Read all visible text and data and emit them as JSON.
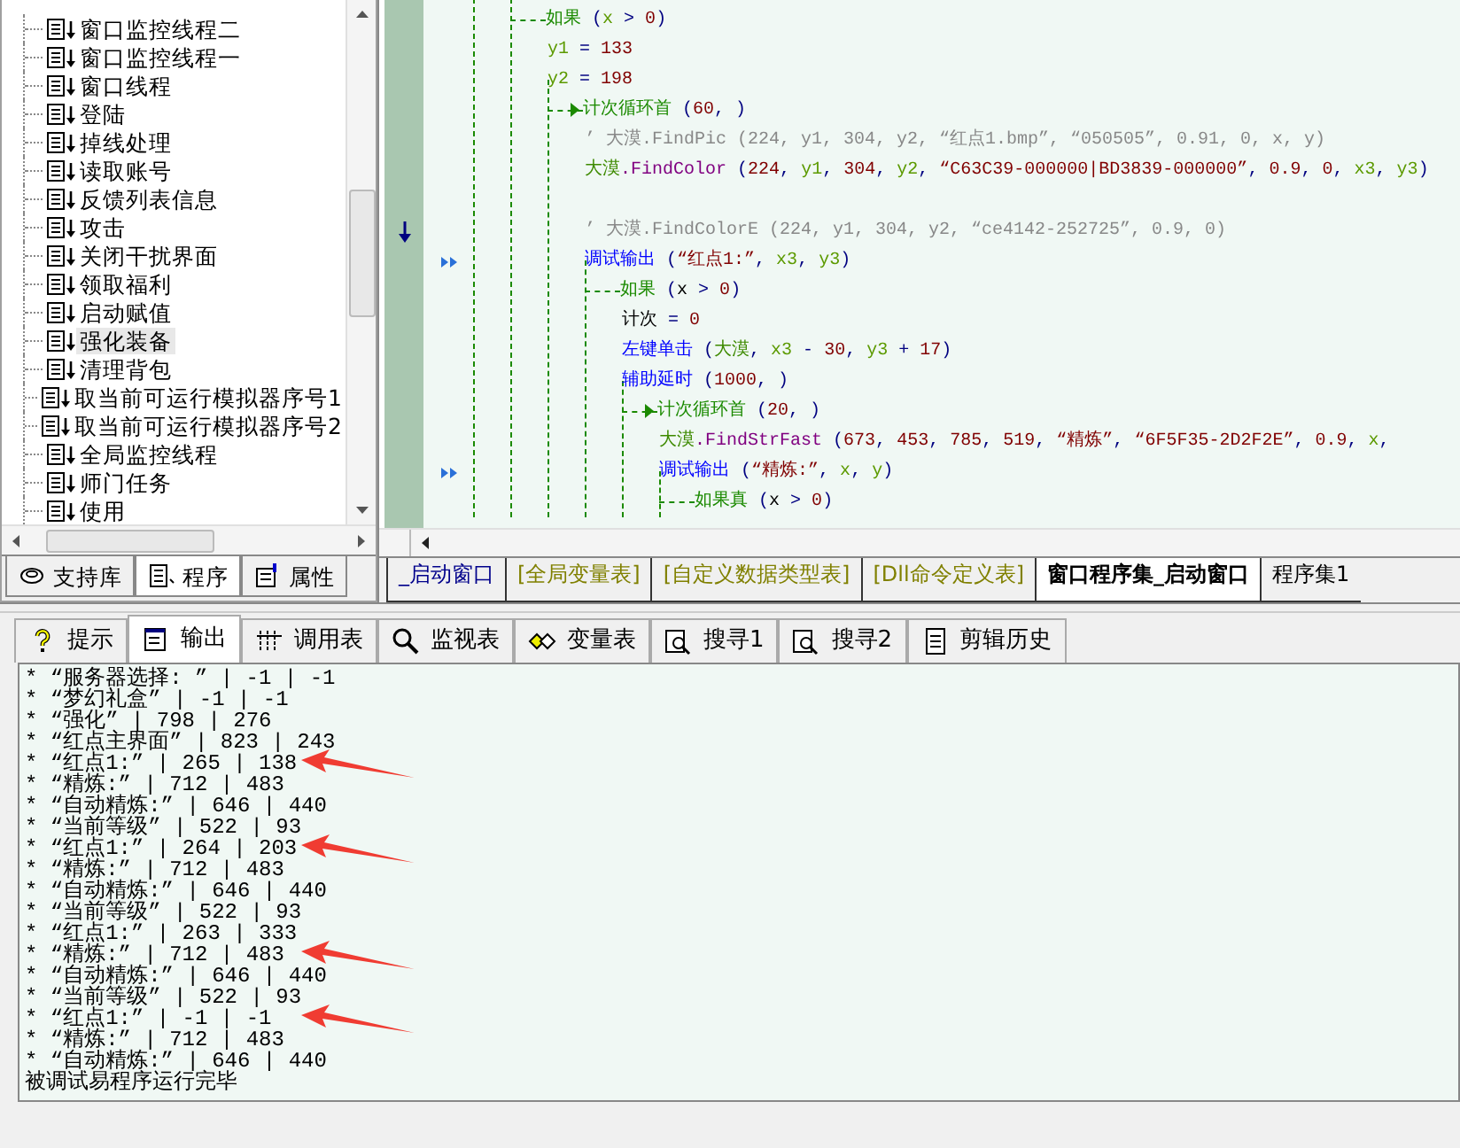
{
  "tree": {
    "items": [
      {
        "label": "窗口监控线程二",
        "selected": false
      },
      {
        "label": "窗口监控线程一",
        "selected": false
      },
      {
        "label": "窗口线程",
        "selected": false
      },
      {
        "label": "登陆",
        "selected": false
      },
      {
        "label": "掉线处理",
        "selected": false
      },
      {
        "label": "读取账号",
        "selected": false
      },
      {
        "label": "反馈列表信息",
        "selected": false
      },
      {
        "label": "攻击",
        "selected": false
      },
      {
        "label": "关闭干扰界面",
        "selected": false
      },
      {
        "label": "领取福利",
        "selected": false
      },
      {
        "label": "启动赋值",
        "selected": false
      },
      {
        "label": "强化装备",
        "selected": true
      },
      {
        "label": "清理背包",
        "selected": false
      },
      {
        "label": "取当前可运行模拟器序号1",
        "selected": false
      },
      {
        "label": "取当前可运行模拟器序号2",
        "selected": false
      },
      {
        "label": "全局监控线程",
        "selected": false
      },
      {
        "label": "师门任务",
        "selected": false
      },
      {
        "label": "使用",
        "selected": false
      }
    ]
  },
  "left_tabs": [
    {
      "label": "支持库",
      "selected": false
    },
    {
      "label": "程序",
      "selected": true
    },
    {
      "label": "属性",
      "selected": false
    }
  ],
  "code": {
    "lines": [
      {
        "kind": "if",
        "tokens": [
          {
            "kind": "flow",
            "text": "如果"
          },
          {
            "kind": "op",
            "text": " ("
          },
          {
            "kind": "var",
            "text": "x"
          },
          {
            "kind": "op",
            "text": " > "
          },
          {
            "kind": "num",
            "text": "0"
          },
          {
            "kind": "op",
            "text": ")"
          }
        ],
        "children": [
          {
            "kind": "stmt",
            "tokens": [
              {
                "kind": "var",
                "text": "y1"
              },
              {
                "kind": "op",
                "text": " = "
              },
              {
                "kind": "num",
                "text": "133"
              }
            ]
          },
          {
            "kind": "stmt",
            "tokens": [
              {
                "kind": "var",
                "text": "y2"
              },
              {
                "kind": "op",
                "text": " = "
              },
              {
                "kind": "num",
                "text": "198"
              }
            ]
          },
          {
            "kind": "loop",
            "tokens": [
              {
                "kind": "flow",
                "text": "计次循环首"
              },
              {
                "kind": "op",
                "text": " ("
              },
              {
                "kind": "num",
                "text": "60"
              },
              {
                "kind": "op",
                "text": ", )"
              }
            ],
            "children": [
              {
                "kind": "stmt",
                "tokens": [
                  {
                    "kind": "comment",
                    "text": "’ 大漠.FindPic (224, y1, 304, y2, “红点1.bmp”, “050505”, 0.91, 0, x, y)"
                  }
                ]
              },
              {
                "kind": "stmt",
                "tokens": [
                  {
                    "kind": "obj",
                    "text": "大漠"
                  },
                  {
                    "kind": "method",
                    "text": ".FindColor"
                  },
                  {
                    "kind": "op",
                    "text": " ("
                  },
                  {
                    "kind": "num",
                    "text": "224"
                  },
                  {
                    "kind": "op",
                    "text": ", "
                  },
                  {
                    "kind": "var",
                    "text": "y1"
                  },
                  {
                    "kind": "op",
                    "text": ", "
                  },
                  {
                    "kind": "num",
                    "text": "304"
                  },
                  {
                    "kind": "op",
                    "text": ", "
                  },
                  {
                    "kind": "var",
                    "text": "y2"
                  },
                  {
                    "kind": "op",
                    "text": ", "
                  },
                  {
                    "kind": "str",
                    "text": "“C63C39-000000|BD3839-000000”"
                  },
                  {
                    "kind": "op",
                    "text": ", "
                  },
                  {
                    "kind": "num",
                    "text": "0.9"
                  },
                  {
                    "kind": "op",
                    "text": ", "
                  },
                  {
                    "kind": "num",
                    "text": "0"
                  },
                  {
                    "kind": "op",
                    "text": ", "
                  },
                  {
                    "kind": "var",
                    "text": "x3"
                  },
                  {
                    "kind": "op",
                    "text": ", "
                  },
                  {
                    "kind": "var",
                    "text": "y3"
                  },
                  {
                    "kind": "op",
                    "text": ")"
                  }
                ]
              },
              {
                "kind": "blank"
              },
              {
                "kind": "stmt",
                "current": true,
                "traced": false,
                "tokens": [
                  {
                    "kind": "comment",
                    "text": "’ 大漠.FindColorE (224, y1, 304, y2, “ce4142-252725”, 0.9, 0)"
                  }
                ]
              },
              {
                "kind": "stmt",
                "current": false,
                "traced": true,
                "tokens": [
                  {
                    "kind": "cmd",
                    "text": "调试输出"
                  },
                  {
                    "kind": "op",
                    "text": " ("
                  },
                  {
                    "kind": "str",
                    "text": "“红点1:”"
                  },
                  {
                    "kind": "op",
                    "text": ", "
                  },
                  {
                    "kind": "var",
                    "text": "x3"
                  },
                  {
                    "kind": "op",
                    "text": ", "
                  },
                  {
                    "kind": "var",
                    "text": "y3"
                  },
                  {
                    "kind": "op",
                    "text": ")"
                  }
                ]
              },
              {
                "kind": "if",
                "tokens": [
                  {
                    "kind": "flow",
                    "text": "如果"
                  },
                  {
                    "kind": "op",
                    "text": " ("
                  },
                  {
                    "kind": "plain",
                    "text": "x"
                  },
                  {
                    "kind": "op",
                    "text": " > "
                  },
                  {
                    "kind": "num",
                    "text": "0"
                  },
                  {
                    "kind": "op",
                    "text": ")"
                  }
                ],
                "children": [
                  {
                    "kind": "stmt",
                    "tokens": [
                      {
                        "kind": "plain",
                        "text": "计次"
                      },
                      {
                        "kind": "op",
                        "text": " = "
                      },
                      {
                        "kind": "num",
                        "text": "0"
                      }
                    ]
                  },
                  {
                    "kind": "stmt",
                    "tokens": [
                      {
                        "kind": "cmd",
                        "text": "左键单击"
                      },
                      {
                        "kind": "op",
                        "text": " ("
                      },
                      {
                        "kind": "obj",
                        "text": "大漠"
                      },
                      {
                        "kind": "op",
                        "text": ", "
                      },
                      {
                        "kind": "var",
                        "text": "x3"
                      },
                      {
                        "kind": "op",
                        "text": " - "
                      },
                      {
                        "kind": "num",
                        "text": "30"
                      },
                      {
                        "kind": "op",
                        "text": ", "
                      },
                      {
                        "kind": "var",
                        "text": "y3"
                      },
                      {
                        "kind": "op",
                        "text": " + "
                      },
                      {
                        "kind": "num",
                        "text": "17"
                      },
                      {
                        "kind": "op",
                        "text": ")"
                      }
                    ]
                  },
                  {
                    "kind": "stmt",
                    "tokens": [
                      {
                        "kind": "cmd",
                        "text": "辅助延时"
                      },
                      {
                        "kind": "op",
                        "text": " ("
                      },
                      {
                        "kind": "num",
                        "text": "1000"
                      },
                      {
                        "kind": "op",
                        "text": ", )"
                      }
                    ]
                  },
                  {
                    "kind": "loop",
                    "tokens": [
                      {
                        "kind": "flow",
                        "text": "计次循环首"
                      },
                      {
                        "kind": "op",
                        "text": " ("
                      },
                      {
                        "kind": "num",
                        "text": "20"
                      },
                      {
                        "kind": "op",
                        "text": ", )"
                      }
                    ],
                    "children": [
                      {
                        "kind": "stmt",
                        "tokens": [
                          {
                            "kind": "obj",
                            "text": "大漠"
                          },
                          {
                            "kind": "method",
                            "text": ".FindStrFast"
                          },
                          {
                            "kind": "op",
                            "text": " ("
                          },
                          {
                            "kind": "num",
                            "text": "673"
                          },
                          {
                            "kind": "op",
                            "text": ", "
                          },
                          {
                            "kind": "num",
                            "text": "453"
                          },
                          {
                            "kind": "op",
                            "text": ", "
                          },
                          {
                            "kind": "num",
                            "text": "785"
                          },
                          {
                            "kind": "op",
                            "text": ", "
                          },
                          {
                            "kind": "num",
                            "text": "519"
                          },
                          {
                            "kind": "op",
                            "text": ", "
                          },
                          {
                            "kind": "str",
                            "text": "“精炼”"
                          },
                          {
                            "kind": "op",
                            "text": ", "
                          },
                          {
                            "kind": "str",
                            "text": "“6F5F35-2D2F2E”"
                          },
                          {
                            "kind": "op",
                            "text": ", "
                          },
                          {
                            "kind": "num",
                            "text": "0.9"
                          },
                          {
                            "kind": "op",
                            "text": ", "
                          },
                          {
                            "kind": "var",
                            "text": "x"
                          },
                          {
                            "kind": "op",
                            "text": ","
                          }
                        ]
                      },
                      {
                        "kind": "stmt",
                        "current": false,
                        "traced": true,
                        "tokens": [
                          {
                            "kind": "cmd",
                            "text": "调试输出"
                          },
                          {
                            "kind": "op",
                            "text": " ("
                          },
                          {
                            "kind": "str",
                            "text": "“精炼:”"
                          },
                          {
                            "kind": "op",
                            "text": ", "
                          },
                          {
                            "kind": "var",
                            "text": "x"
                          },
                          {
                            "kind": "op",
                            "text": ", "
                          },
                          {
                            "kind": "var",
                            "text": "y"
                          },
                          {
                            "kind": "op",
                            "text": ")"
                          }
                        ]
                      },
                      {
                        "kind": "if",
                        "tokens": [
                          {
                            "kind": "flow",
                            "text": "如果真"
                          },
                          {
                            "kind": "op",
                            "text": " ("
                          },
                          {
                            "kind": "plain",
                            "text": "x"
                          },
                          {
                            "kind": "op",
                            "text": " > "
                          },
                          {
                            "kind": "num",
                            "text": "0"
                          },
                          {
                            "kind": "op",
                            "text": ")"
                          }
                        ]
                      }
                    ]
                  }
                ]
              }
            ]
          }
        ]
      }
    ]
  },
  "editor_tabs": [
    {
      "label": "_启动窗口",
      "kind": "window",
      "selected": false
    },
    {
      "label": "[全局变量表]",
      "kind": "table",
      "selected": false
    },
    {
      "label": "[自定义数据类型表]",
      "kind": "table",
      "selected": false
    },
    {
      "label": "[Dll命令定义表]",
      "kind": "table",
      "selected": false
    },
    {
      "label": "窗口程序集_启动窗口",
      "kind": "class",
      "selected": true
    },
    {
      "label": "程序集1",
      "kind": "class",
      "selected": false
    }
  ],
  "output_tabs": [
    {
      "label": "提示",
      "selected": false
    },
    {
      "label": "输出",
      "selected": true
    },
    {
      "label": "调用表",
      "selected": false
    },
    {
      "label": "监视表",
      "selected": false
    },
    {
      "label": "变量表",
      "selected": false
    },
    {
      "label": "搜寻1",
      "selected": false
    },
    {
      "label": "搜寻2",
      "selected": false
    },
    {
      "label": "剪辑历史",
      "selected": false
    }
  ],
  "output": {
    "lines": [
      {
        "text": "* “服务器选择: ” | -1 | -1",
        "arrow": false
      },
      {
        "text": "* “梦幻礼盒” | -1 | -1",
        "arrow": false
      },
      {
        "text": "* “强化” | 798 | 276",
        "arrow": false
      },
      {
        "text": "* “红点主界面” | 823 | 243",
        "arrow": false
      },
      {
        "text": "* “红点1:” | 265 | 138",
        "arrow": true
      },
      {
        "text": "* “精炼:” | 712 | 483",
        "arrow": false
      },
      {
        "text": "* “自动精炼:” | 646 | 440",
        "arrow": false
      },
      {
        "text": "* “当前等级” | 522 | 93",
        "arrow": false
      },
      {
        "text": "* “红点1:” | 264 | 203",
        "arrow": true
      },
      {
        "text": "* “精炼:” | 712 | 483",
        "arrow": false
      },
      {
        "text": "* “自动精炼:” | 646 | 440",
        "arrow": false
      },
      {
        "text": "* “当前等级” | 522 | 93",
        "arrow": false
      },
      {
        "text": "* “红点1:” | 263 | 333",
        "arrow": false
      },
      {
        "text": "* “精炼:” | 712 | 483",
        "arrow": true
      },
      {
        "text": "* “自动精炼:” | 646 | 440",
        "arrow": false
      },
      {
        "text": "* “当前等级” | 522 | 93",
        "arrow": false
      },
      {
        "text": "* “红点1:” | -1 | -1",
        "arrow": true
      },
      {
        "text": "* “精炼:” | 712 | 483",
        "arrow": false
      },
      {
        "text": "* “自动精炼:” | 646 | 440",
        "arrow": false
      },
      {
        "text": "被调试易程序运行完毕",
        "arrow": false
      }
    ]
  }
}
